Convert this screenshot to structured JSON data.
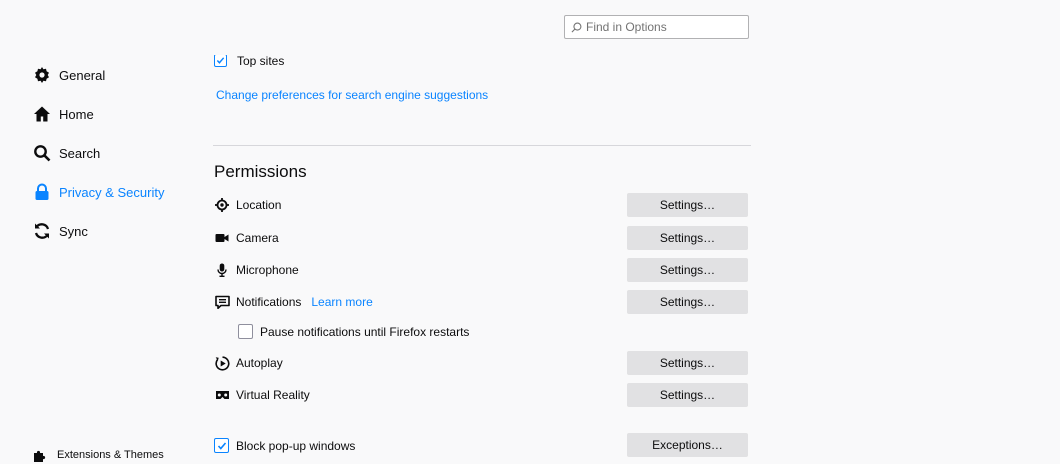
{
  "search": {
    "placeholder": "Find in Options"
  },
  "sidebar": {
    "items": [
      {
        "label": "General",
        "icon": "gear-icon"
      },
      {
        "label": "Home",
        "icon": "home-icon"
      },
      {
        "label": "Search",
        "icon": "search-icon"
      },
      {
        "label": "Privacy & Security",
        "icon": "lock-icon",
        "active": true
      },
      {
        "label": "Sync",
        "icon": "sync-icon"
      }
    ],
    "extensions_label": "Extensions & Themes"
  },
  "main": {
    "top_sites_label": "Top sites",
    "search_suggestions_link": "Change preferences for search engine suggestions",
    "permissions_heading": "Permissions",
    "permissions": [
      {
        "label": "Location",
        "icon": "location-icon",
        "button": "Settings…"
      },
      {
        "label": "Camera",
        "icon": "camera-icon",
        "button": "Settings…"
      },
      {
        "label": "Microphone",
        "icon": "microphone-icon",
        "button": "Settings…"
      },
      {
        "label": "Notifications",
        "icon": "notifications-icon",
        "button": "Settings…",
        "link": "Learn more"
      },
      {
        "label": "Autoplay",
        "icon": "autoplay-icon",
        "button": "Settings…"
      },
      {
        "label": "Virtual Reality",
        "icon": "vr-icon",
        "button": "Settings…"
      }
    ],
    "pause_notifications_label": "Pause notifications until Firefox restarts",
    "block_popups_label": "Block pop-up windows",
    "exceptions_button": "Exceptions…"
  },
  "colors": {
    "accent": "#0a84ff",
    "button_bg": "#e1e1e3",
    "background": "#f9f9fa"
  }
}
